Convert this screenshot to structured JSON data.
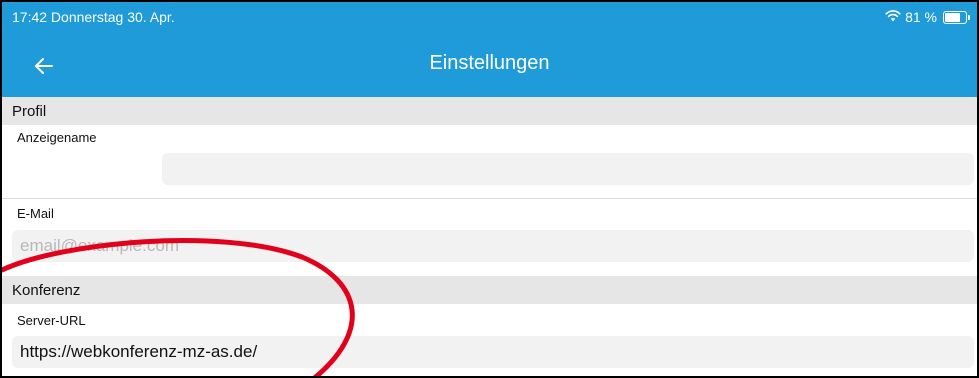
{
  "status_bar": {
    "time_date": "17:42  Donnerstag 30. Apr.",
    "battery_text": "81 %",
    "battery_level": 0.81,
    "wifi_icon": "wifi-icon",
    "battery_icon": "battery-icon"
  },
  "header": {
    "title": "Einstellungen",
    "back_icon": "arrow-left-icon"
  },
  "sections": {
    "profil": {
      "label": "Profil",
      "display_name_label": "Anzeigename",
      "display_name_value": "",
      "email_label": "E-Mail",
      "email_placeholder": "email@example.com",
      "email_value": ""
    },
    "konferenz": {
      "label": "Konferenz",
      "server_url_label": "Server-URL",
      "server_url_value": "https://webkonferenz-mz-as.de/"
    }
  },
  "colors": {
    "header_background": "#1e9bd8",
    "section_background": "#e6e6e6",
    "input_background": "#f2f2f2",
    "annotation": "#e3001b"
  }
}
